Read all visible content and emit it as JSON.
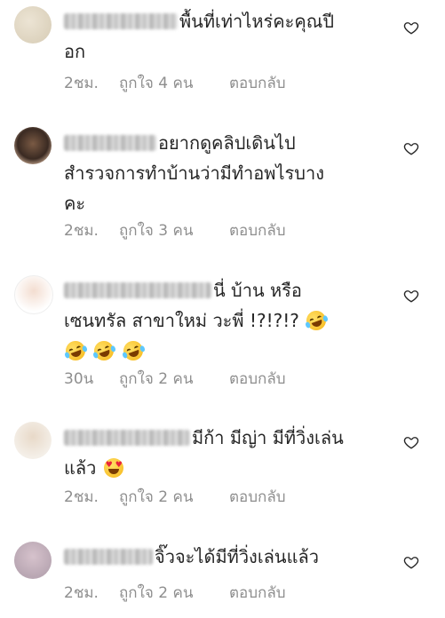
{
  "comments": [
    {
      "text": "พื้นที่เท่าไหร่คะคุณปี\nอก",
      "time": "2ชม.",
      "likes": "ถูกใจ 4 คน",
      "reply": "ตอบกลับ"
    },
    {
      "text": "อยากดูคลิปเดินไป\nสำรวจการทำบ้านว่ามีทำอพไรบาง\nคะ",
      "time": "2ชม.",
      "likes": "ถูกใจ 3 คน",
      "reply": "ตอบกลับ"
    },
    {
      "text": "นี่ บ้าน หรือ\nเซนทรัล สาขาใหม่ วะพี่ !?!?!?",
      "time": "30น",
      "likes": "ถูกใจ 2 คน",
      "reply": "ตอบกลับ"
    },
    {
      "text": "มีก้า มีญ่า มีที่วิ่งเล่น\nแล้ว",
      "time": "2ชม.",
      "likes": "ถูกใจ 2 คน",
      "reply": "ตอบกลับ"
    },
    {
      "text": "จิ๊วจะได้มีที่วิ่งเล่นแล้ว",
      "time": "2ชม.",
      "likes": "ถูกใจ 2 คน",
      "reply": "ตอบกลับ"
    }
  ],
  "emoji": {
    "rofl": "rolling-on-floor-laughing",
    "heart_eyes": "smiling-face-with-heart-eyes"
  },
  "colors": {
    "text": "#262626",
    "meta": "#8e8e8e",
    "heart_outline": "#262626"
  }
}
